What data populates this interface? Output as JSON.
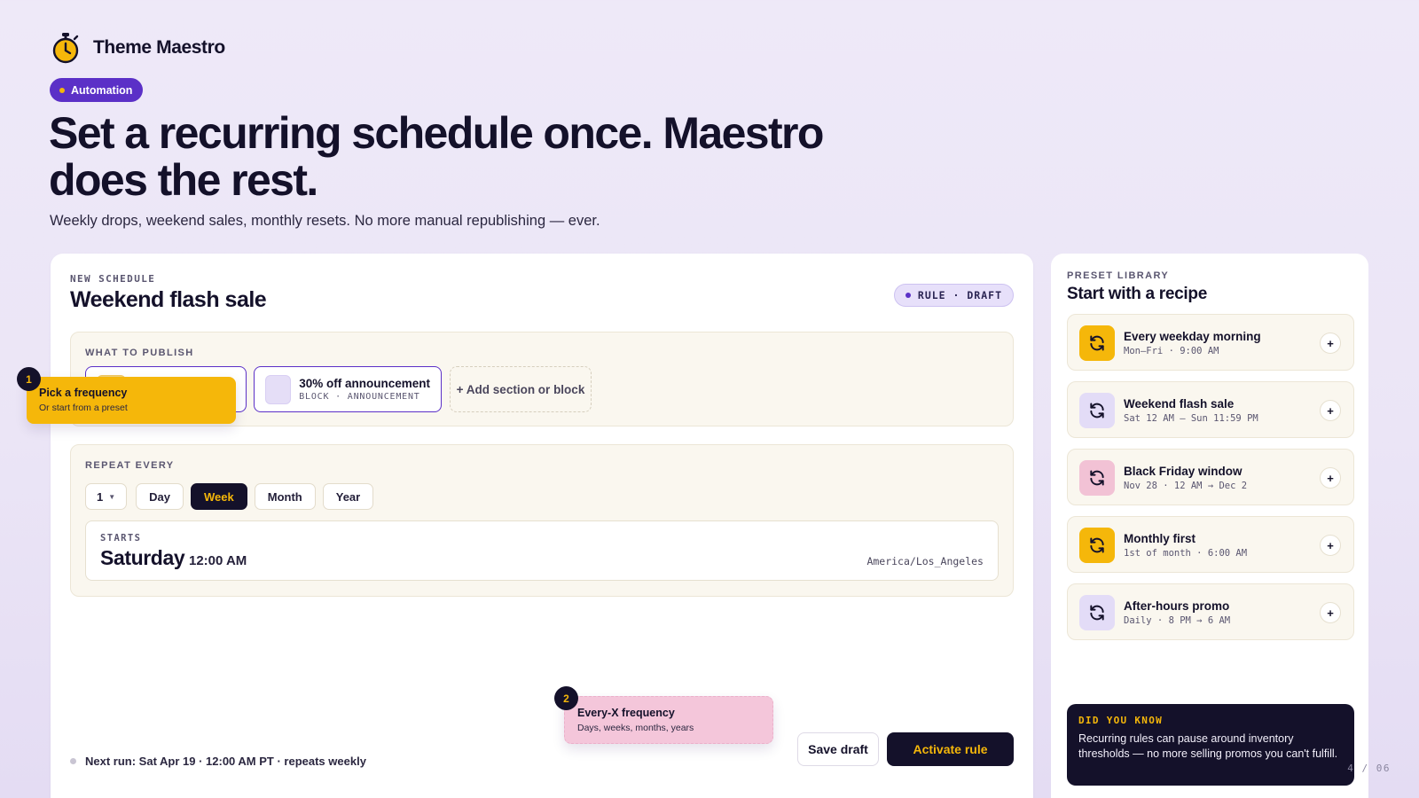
{
  "brand": {
    "name": "Theme Maestro",
    "logo_icon": "stopwatch-icon",
    "accent": "#f5b70a"
  },
  "tag": {
    "label": "Automation",
    "color": "#5b30c7"
  },
  "hero": {
    "title": "Set a recurring schedule once. Maestro does the rest.",
    "subtitle": "Weekly drops, weekend sales, monthly resets. No more manual republishing — ever."
  },
  "schedule": {
    "eyebrow": "NEW SCHEDULE",
    "title": "Weekend flash sale",
    "status": "RULE · DRAFT",
    "publish": {
      "eyebrow": "WHAT TO PUBLISH",
      "blocks": [
        {
          "title": "",
          "meta": ""
        },
        {
          "title": "30% off announcement",
          "meta": "BLOCK · ANNOUNCEMENT"
        }
      ],
      "add_label": "+ Add section or block"
    },
    "repeat": {
      "eyebrow": "REPEAT EVERY",
      "interval": "1",
      "units": [
        "Day",
        "Week",
        "Month",
        "Year"
      ],
      "selected_unit": "Week"
    },
    "starts": {
      "eyebrow": "STARTS",
      "day": "Saturday",
      "time": "12:00 AM",
      "timezone": "America/Los_Angeles"
    },
    "next_run": "Next run: Sat Apr 19 · 12:00 AM PT · repeats weekly",
    "save_label": "Save draft",
    "activate_label": "Activate rule"
  },
  "callouts": [
    {
      "number": "1",
      "title": "Pick a frequency",
      "subtitle": "Or start from a preset"
    },
    {
      "number": "2",
      "title": "Every-X frequency",
      "subtitle": "Days, weeks, months, years"
    }
  ],
  "library": {
    "eyebrow": "PRESET LIBRARY",
    "title": "Start with a recipe",
    "add_glyph": "+",
    "presets": [
      {
        "name": "Every weekday morning",
        "meta": "Mon–Fri · 9:00 AM",
        "icon": "refresh-icon",
        "tone": "yellow"
      },
      {
        "name": "Weekend flash sale",
        "meta": "Sat 12 AM – Sun 11:59 PM",
        "icon": "refresh-icon",
        "tone": "lilac"
      },
      {
        "name": "Black Friday window",
        "meta": "Nov 28 · 12 AM → Dec 2",
        "icon": "refresh-icon",
        "tone": "pink"
      },
      {
        "name": "Monthly first",
        "meta": "1st of month · 6:00 AM",
        "icon": "refresh-icon",
        "tone": "yellow"
      },
      {
        "name": "After-hours promo",
        "meta": "Daily · 8 PM → 6 AM",
        "icon": "refresh-icon",
        "tone": "lilac"
      }
    ]
  },
  "tip": {
    "eyebrow": "DID YOU KNOW",
    "body": "Recurring rules can pause around inventory thresholds — no more selling promos you can't fulfill."
  },
  "pagination": "4 / 06"
}
